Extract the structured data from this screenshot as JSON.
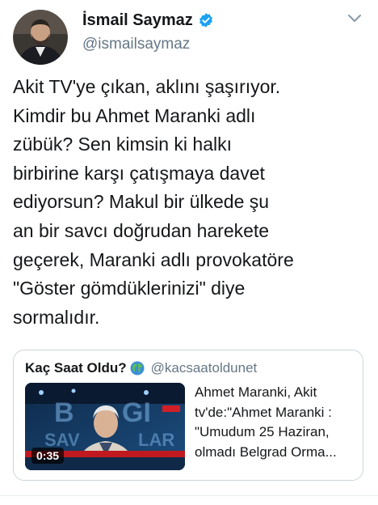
{
  "author": {
    "display_name": "İsmail Saymaz",
    "handle": "@ismailsaymaz",
    "verified": true,
    "avatar_icon": "profile-photo"
  },
  "menu": {
    "icon": "chevron-down-icon"
  },
  "tweet": {
    "text_lines": [
      "Akit TV'ye çıkan, aklını şaşırıyor.",
      "Kimdir bu Ahmet Maranki adlı",
      "zübük? Sen kimsin ki halkı",
      "birbirine karşı çatışmaya davet",
      "ediyorsun? Makul bir ülkede şu",
      "an bir savcı doğrudan harekete",
      "geçerek, Maranki adlı provokatöre",
      "\"Göster gömdüklerinizi\" diye",
      "sormalıdır."
    ]
  },
  "quoted": {
    "display_name": "Kaç Saat Oldu?",
    "emoji_icon": "globe-icon",
    "handle": "@kacsaatoldunet",
    "video_duration": "0:35",
    "text_lines": [
      "Ahmet Maranki, Akit",
      "tv'de:\"Ahmet Maranki :",
      "\"Umudum 25 Haziran,",
      "olmadı Belgrad Orma..."
    ]
  },
  "colors": {
    "text": "#14171a",
    "secondary": "#657786",
    "verified_blue": "#1da1f2",
    "border": "#ccd6dd"
  }
}
